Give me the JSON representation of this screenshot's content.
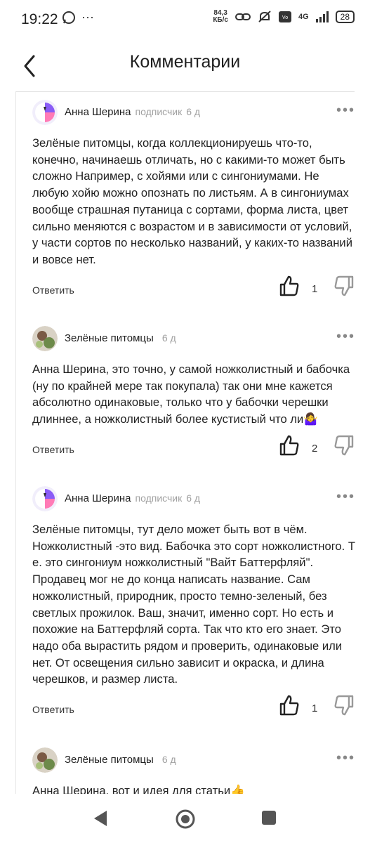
{
  "status": {
    "time": "19:22",
    "netspeed_value": "84,3",
    "netspeed_unit": "КБ/с",
    "network": "4G",
    "battery": "28",
    "more": "···"
  },
  "header": {
    "title": "Комментарии"
  },
  "comments": [
    {
      "author": "Анна Шерина",
      "role": "подписчик",
      "time": "6 д",
      "text": "Зелёные питомцы, когда коллекционируешь что-то, конечно, начинаешь отличать, но с какими-то может быть сложно Например, с хойями или с сингониумами. Не любую хойю можно опознать по листьям. А в сингониумах вообще страшная путаница с сортами, форма листа, цвет сильно меняются с возрастом и в зависимости от условий, у части сортов по несколько названий, у каких-то названий и вовсе нет.",
      "reply_label": "Ответить",
      "likes": "1"
    },
    {
      "author": "Зелёные питомцы",
      "role": "",
      "time": "6 д",
      "text": "Анна Шерина, это точно, у самой ножколистный и бабочка (ну по крайней мере так покупала) так они мне кажется абсолютно одинаковые, только что у бабочки черешки длиннее, а ножколистный более кустистый что ли🤷‍♀️",
      "reply_label": "Ответить",
      "likes": "2"
    },
    {
      "author": "Анна Шерина",
      "role": "подписчик",
      "time": "6 д",
      "text": "Зелёные питомцы, тут дело может быть вот в чём. Ножколистный -это вид. Бабочка это сорт ножколистного. Т е. это сингониум ножколистный \"Вайт Баттерфляй\". Продавец мог не до конца написать название.  Сам ножколистный, природник, просто темно-зеленый, без светлых прожилок. Ваш, значит, именно сорт. Но есть и похожие на Баттерфляй сорта. Так что кто его знает. Это надо оба вырастить рядом и проверить, одинаковые или нет. От освещения сильно зависит и окраска, и длина черешков, и размер листа.",
      "reply_label": "Ответить",
      "likes": "1"
    },
    {
      "author": "Зелёные питомцы",
      "role": "",
      "time": "6 д",
      "text": "Анна Шерина, вот и идея для статьи👍"
    }
  ],
  "icons": {
    "back": "chevron-left-icon",
    "more": "more-horizontal-icon",
    "like": "thumb-up-icon",
    "dislike": "thumb-down-icon",
    "accent": "#8a5cf6",
    "pink": "#ff7bb6"
  }
}
